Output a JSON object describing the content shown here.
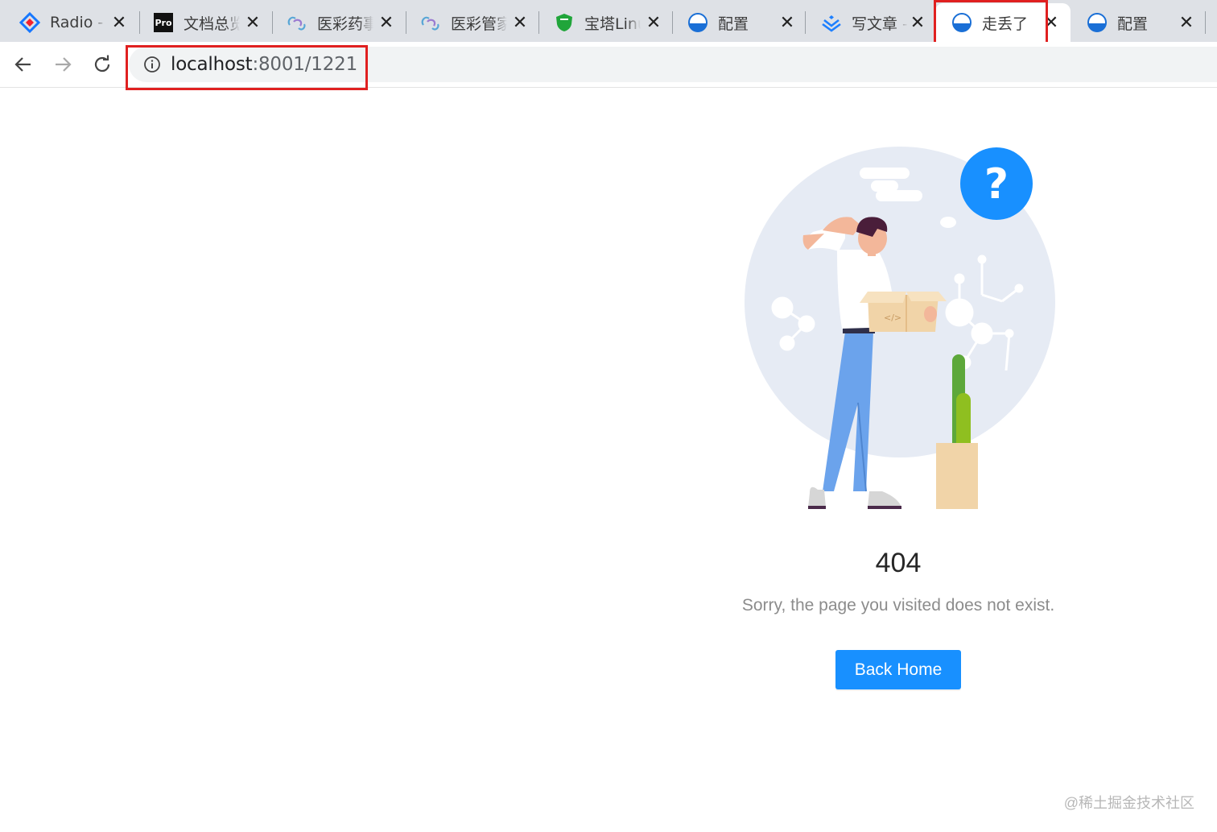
{
  "browser": {
    "tabs": [
      {
        "title": "Radio -",
        "icon": "antd-logo-icon"
      },
      {
        "title": "文档总览",
        "icon": "pro-logo-icon"
      },
      {
        "title": "医彩药事",
        "icon": "chain-link-icon"
      },
      {
        "title": "医彩管家",
        "icon": "chain-link-icon"
      },
      {
        "title": "宝塔Linux",
        "icon": "green-shield-icon"
      },
      {
        "title": "配置",
        "icon": "globe-icon"
      },
      {
        "title": "写文章 -",
        "icon": "juejin-logo-icon"
      },
      {
        "title": "走丢了",
        "icon": "globe-icon",
        "active": true
      },
      {
        "title": "配置",
        "icon": "globe-icon"
      }
    ],
    "close_glyph": "✕",
    "address": {
      "host": "localhost",
      "rest": ":8001/1221"
    },
    "highlight_color": "#e02020"
  },
  "page": {
    "status": "404",
    "subtitle": "Sorry, the page you visited does not exist.",
    "back_home_label": "Back Home",
    "button_color": "#1890ff"
  },
  "watermark": "@稀土掘金技术社区"
}
